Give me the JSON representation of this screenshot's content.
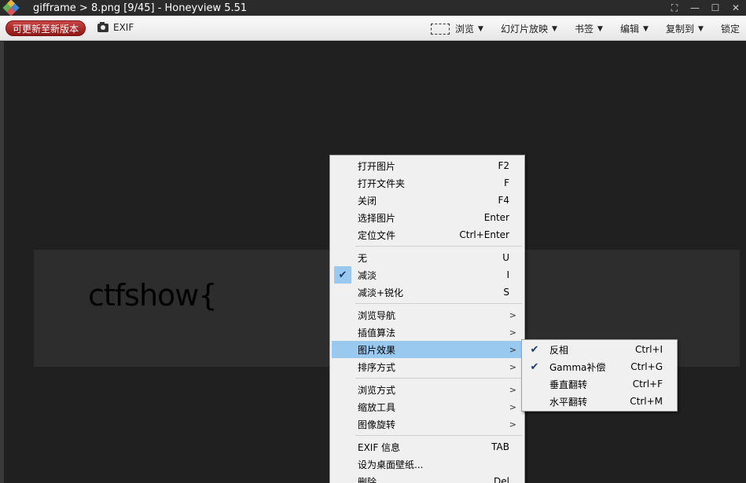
{
  "window": {
    "title": "gifframe > 8.png [9/45] - Honeyview 5.51",
    "controls": [
      "⛶",
      "—",
      "☐",
      "✕"
    ]
  },
  "toolbar": {
    "update_label": "可更新至新版本",
    "exif_label": "EXIF",
    "items": [
      {
        "label": "浏览",
        "icon": "browse-icon"
      },
      {
        "label": "幻灯片放映"
      },
      {
        "label": "书签"
      },
      {
        "label": "编辑"
      },
      {
        "label": "复制到"
      },
      {
        "label": "锁定"
      }
    ]
  },
  "image": {
    "text": "ctfshow{"
  },
  "context_menu": {
    "items": [
      {
        "label": "打开图片",
        "shortcut": "F2"
      },
      {
        "label": "打开文件夹",
        "shortcut": "F"
      },
      {
        "label": "关闭",
        "shortcut": "F4"
      },
      {
        "label": "选择图片",
        "shortcut": "Enter"
      },
      {
        "label": "定位文件",
        "shortcut": "Ctrl+Enter"
      },
      {
        "label": "无",
        "shortcut": "U"
      },
      {
        "label": "减淡",
        "shortcut": "I",
        "checked": true
      },
      {
        "label": "减淡+锐化",
        "shortcut": "S"
      },
      {
        "label": "浏览导航",
        "submenu": true
      },
      {
        "label": "插值算法",
        "submenu": true
      },
      {
        "label": "图片效果",
        "submenu": true,
        "highlighted": true
      },
      {
        "label": "排序方式",
        "submenu": true
      },
      {
        "label": "浏览方式",
        "submenu": true
      },
      {
        "label": "缩放工具",
        "submenu": true
      },
      {
        "label": "图像旋转",
        "submenu": true
      },
      {
        "label": "EXIF 信息",
        "shortcut": "TAB"
      },
      {
        "label": "设为桌面壁纸..."
      },
      {
        "label": "删除",
        "shortcut": "Del"
      }
    ]
  },
  "submenu": {
    "items": [
      {
        "label": "反相",
        "shortcut": "Ctrl+I",
        "checked": true
      },
      {
        "label": "Gamma补偿",
        "shortcut": "Ctrl+G",
        "checked": true
      },
      {
        "label": "垂直翻转",
        "shortcut": "Ctrl+F"
      },
      {
        "label": "水平翻转",
        "shortcut": "Ctrl+M"
      }
    ]
  },
  "colors": {
    "highlight": "#99c9ef",
    "update_button": "#b02a2a",
    "viewer_bg": "#202020"
  }
}
